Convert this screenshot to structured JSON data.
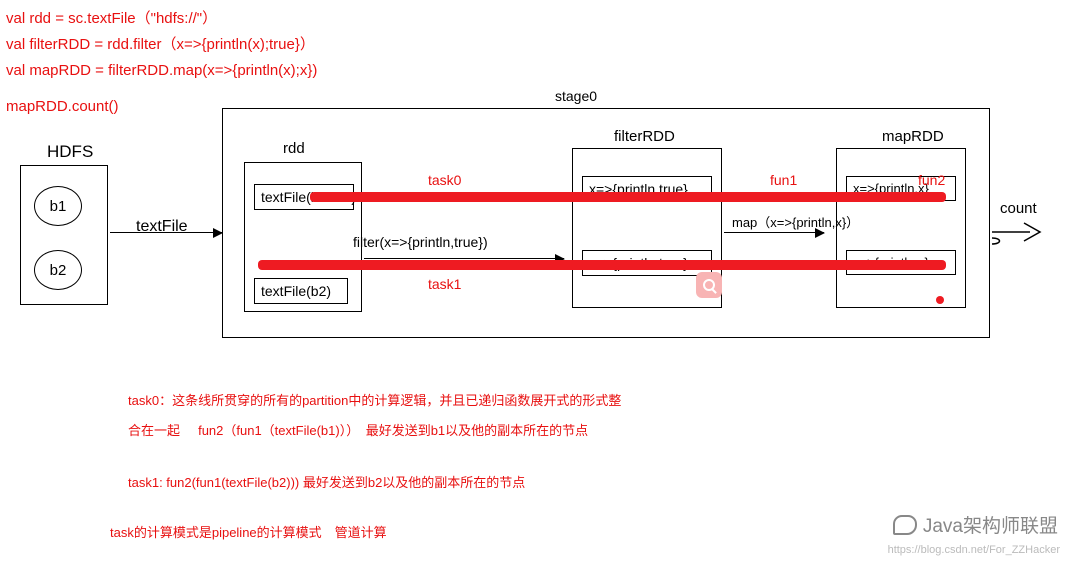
{
  "code": {
    "line1": "val rdd = sc.textFile（\"hdfs://\"）",
    "line2": "val filterRDD = rdd.filter（x=>{println(x);true}）",
    "line3": "val mapRDD = filterRDD.map(x=>{println(x);x})",
    "line4": "mapRDD.count()"
  },
  "diagram": {
    "stage_label": "stage0",
    "hdfs": {
      "title": "HDFS",
      "blocks": [
        "b1",
        "b2"
      ],
      "op": "textFile"
    },
    "rdds": {
      "rdd": {
        "title": "rdd",
        "partitions": [
          "textFile(block1)",
          "textFile(b2)"
        ]
      },
      "filterRDD": {
        "title": "filterRDD",
        "partitions": [
          "x=>{println,true}",
          "x=>{println,true}"
        ]
      },
      "mapRDD": {
        "title": "mapRDD",
        "partitions": [
          "x=>{println,x}",
          "x=>{println,x}"
        ]
      }
    },
    "filter_op": "filter(x=>{println,true})",
    "map_op": "map（x=>{println,x}）",
    "count_op": "count",
    "annotations": {
      "task0": "task0",
      "task1": "task1",
      "fun1": "fun1",
      "fun2": "fun2"
    }
  },
  "notes": {
    "n1a": "task0：这条线所贯穿的所有的partition中的计算逻辑，并且已递归函数展开式的形式整",
    "n1b": "合在一起",
    "n1c": "fun2（fun1（textFile(b1)））　最好发送到b1以及他的副本所在的节点",
    "n2": "task1: fun2(fun1(textFile(b2))) 最好发送到b2以及他的副本所在的节点",
    "n3": "task的计算模式是pipeline的计算模式　管道计算"
  },
  "watermark": {
    "text": "Java架构师联盟",
    "url": "https://blog.csdn.net/For_ZZHacker"
  }
}
